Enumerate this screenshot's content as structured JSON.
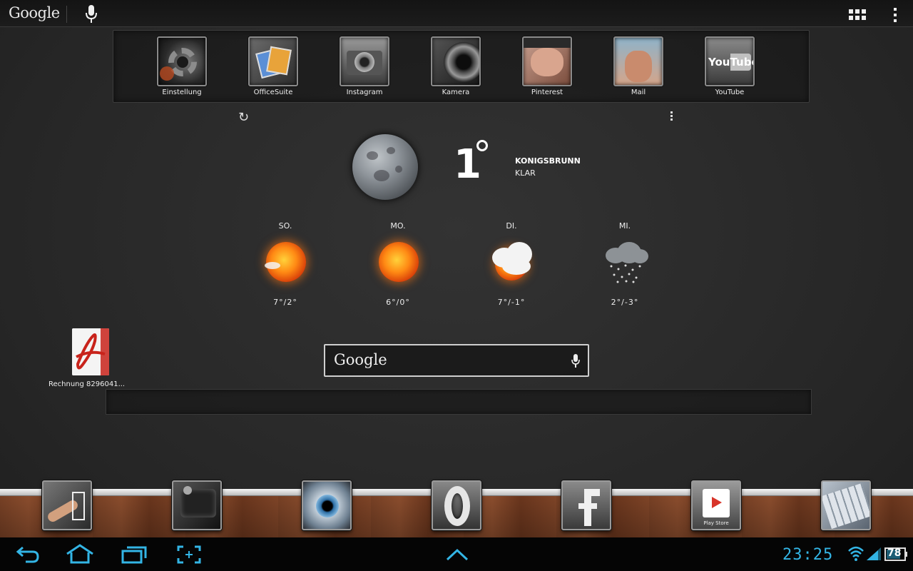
{
  "top_bar": {
    "search_brand": "Google"
  },
  "shelf_apps": [
    {
      "label": "Einstellung",
      "icon": "settings-gears-icon"
    },
    {
      "label": "OfficeSuite",
      "icon": "officesuite-icon"
    },
    {
      "label": "Instagram",
      "icon": "instagram-camera-icon"
    },
    {
      "label": "Kamera",
      "icon": "camera-lens-icon"
    },
    {
      "label": "Pinterest",
      "icon": "pinterest-icon"
    },
    {
      "label": "Mail",
      "icon": "mail-icon"
    },
    {
      "label": "YouTube",
      "icon": "youtube-icon"
    }
  ],
  "youtube_logo": "YouTube",
  "weather": {
    "temperature": "1",
    "city": "KONIGSBRUNN",
    "condition": "KLAR",
    "forecast": [
      {
        "day": "SO.",
        "range": "7°/2°",
        "icon": "sunny-partly-cloudy-icon"
      },
      {
        "day": "MO.",
        "range": "6°/0°",
        "icon": "sunny-icon"
      },
      {
        "day": "DI.",
        "range": "7°/-1°",
        "icon": "cloudy-sun-icon"
      },
      {
        "day": "MI.",
        "range": "2°/-3°",
        "icon": "snow-cloud-icon"
      }
    ]
  },
  "desktop_file": {
    "label": "Rechnung 8296041..."
  },
  "search_widget": {
    "brand": "Google"
  },
  "dock_apps": [
    {
      "icon": "touch-app-icon"
    },
    {
      "icon": "dark-device-icon"
    },
    {
      "icon": "eye-icon"
    },
    {
      "icon": "opera-icon"
    },
    {
      "icon": "facebook-icon"
    },
    {
      "icon": "play-store-icon",
      "label": "Play Store"
    },
    {
      "icon": "keyboard-icon"
    }
  ],
  "status": {
    "time": "23:25",
    "battery": "78"
  },
  "colors": {
    "accent": "#33b5e5",
    "background": "#2a2a2a"
  }
}
